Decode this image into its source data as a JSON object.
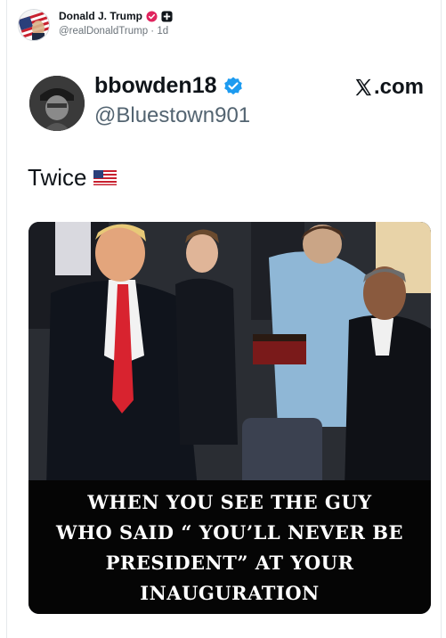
{
  "post": {
    "author_name": "Donald J. Trump",
    "author_handle": "@realDonaldTrump",
    "separator": "·",
    "time": "1d",
    "badge_color": "#e0245e",
    "avatar_icon": "flag-profile-avatar"
  },
  "embedded": {
    "name": "bbowden18",
    "handle": "@Bluestown901",
    "site": ".com",
    "site_logo": "x-logo",
    "verified_color": "#1d9bf0",
    "text": "Twice",
    "emoji": "us-flag-emoji",
    "photo": {
      "caption_lines": [
        "WHEN YOU SEE THE GUY",
        "WHO SAID “ YOU’LL NEVER BE",
        "PRESIDENT” AT YOUR",
        "INAUGURATION"
      ]
    }
  }
}
